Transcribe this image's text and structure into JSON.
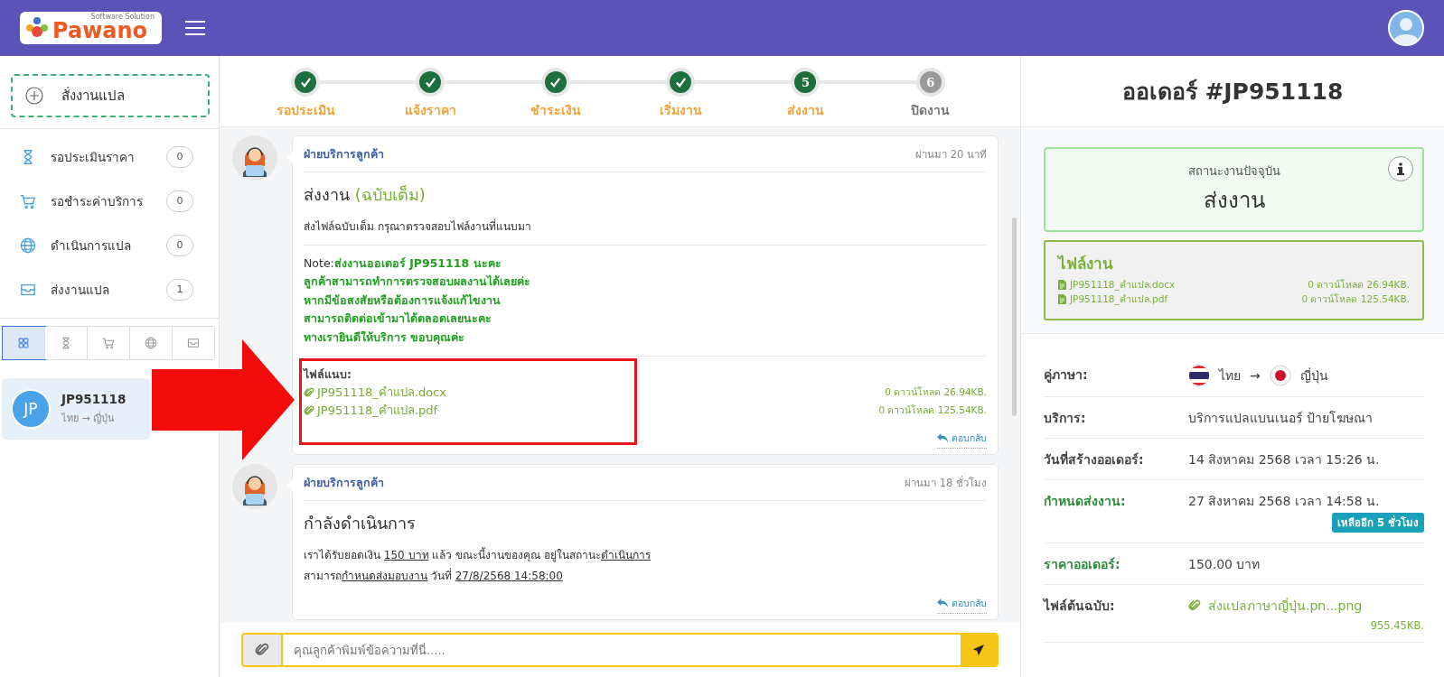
{
  "header": {
    "logo": {
      "name": "Pawano",
      "tagline": "Software Solution"
    }
  },
  "sidebar": {
    "new_order": "สั่งงานแปล",
    "menu": [
      {
        "label": "รอประเมินราคา",
        "count": "0"
      },
      {
        "label": "รอชำระค่าบริการ",
        "count": "0"
      },
      {
        "label": "ดำเนินการแปล",
        "count": "0"
      },
      {
        "label": "ส่งงานแปล",
        "count": "1"
      }
    ],
    "filters": [
      {
        "selected": true
      },
      {
        "selected": false
      },
      {
        "selected": false
      },
      {
        "selected": false
      },
      {
        "selected": false
      }
    ],
    "orders": [
      {
        "initials": "JP",
        "code": "JP951118",
        "languages": "ไทย → ญี่ปุ่น",
        "selected": true
      }
    ]
  },
  "steps": [
    {
      "label": "รอประเมิน",
      "completed": true,
      "active": true
    },
    {
      "label": "แจ้งราคา",
      "completed": true,
      "active": true
    },
    {
      "label": "ชำระเงิน",
      "completed": true,
      "active": true
    },
    {
      "label": "เริ่มงาน",
      "completed": true,
      "active": true
    },
    {
      "label": "ส่งงาน",
      "completed": false,
      "active": true,
      "number": "5"
    },
    {
      "label": "ปิดงาน",
      "completed": false,
      "active": false,
      "number": "6"
    }
  ],
  "messages": [
    {
      "sender": "ฝ่ายบริการลูกค้า",
      "time": "ผ่านมา 20 นาที",
      "title": "ส่งงาน",
      "title_note": "(ฉบับเต็ม)",
      "body": [
        [
          {
            "text": "ส่งไฟล์ฉบับเต็ม กรุณาตรวจสอบไฟล์งานที่แนบมา",
            "underline": false
          }
        ]
      ],
      "note_label": "Note:",
      "note_lines": [
        "ส่งงานออเดอร์ JP951118 นะคะ",
        "ลูกค้าสามารถทำการตรวจสอบผลงานได้เลยค่ะ",
        "หากมีข้อสงสัยหรือต้องการแจ้งแก้ไขงาน",
        "สามารถติดต่อเข้ามาได้ตลอดเลยนะคะ",
        "ทางเรายินดีให้บริการ ขอบคุณค่ะ"
      ],
      "attachments_label": "ไฟล์แนบ:",
      "attachments": [
        {
          "name": "JP951118_คำแปล.docx",
          "info": "0 ดาวน์โหลด 26.94KB."
        },
        {
          "name": "JP951118_คำแปล.pdf",
          "info": "0 ดาวน์โหลด 125.54KB."
        }
      ],
      "reply": "ตอบกลับ"
    },
    {
      "sender": "ฝ่ายบริการลูกค้า",
      "time": "ผ่านมา 18 ชั่วโมง",
      "title": "กำลังดำเนินการ",
      "body": [
        [
          {
            "text": "เราได้รับยอดเงิน ",
            "underline": false
          },
          {
            "text": "150 บาท",
            "underline": true
          },
          {
            "text": " แล้ว ขณะนี้งานของคุณ อยู่ในสถานะ",
            "underline": false
          },
          {
            "text": "ดำเนินการ",
            "underline": true
          }
        ],
        [
          {
            "text": "สามารถ",
            "underline": false
          },
          {
            "text": "กำหนดส่งมอบงาน",
            "underline": true
          },
          {
            "text": " วันที่ ",
            "underline": false
          },
          {
            "text": "27/8/2568 14:58:00",
            "underline": true
          }
        ]
      ],
      "reply": "ตอบกลับ"
    }
  ],
  "composer": {
    "placeholder": "คุณลูกค้าพิมพ์ข้อความที่นี่....."
  },
  "order": {
    "title": "ออเดอร์ #JP951118",
    "status": {
      "label": "สถานะงานปัจจุบัน",
      "value": "ส่งงาน"
    },
    "files": {
      "title": "ไฟล์งาน",
      "items": [
        {
          "name": "JP951118_คำแปล.docx",
          "info": "0 ดาวน์โหลด 26.94KB."
        },
        {
          "name": "JP951118_คำแปล.pdf",
          "info": "0 ดาวน์โหลด 125.54KB."
        }
      ]
    },
    "details": [
      {
        "kind": "languages",
        "label": "คู่ภาษา:",
        "highlight": false,
        "from": "ไทย",
        "arrow": "→",
        "to": "ญี่ปุ่น"
      },
      {
        "kind": "text",
        "label": "บริการ:",
        "highlight": false,
        "value": "บริการแปลแบนเนอร์ ป้ายโฆษณา"
      },
      {
        "kind": "text",
        "label": "วันที่สร้างออเดอร์:",
        "highlight": false,
        "value": "14 สิงหาคม 2568 เวลา 15:26 น."
      },
      {
        "kind": "badge",
        "label": "กำหนดส่งงาน:",
        "highlight": true,
        "value": "27 สิงหาคม 2568 เวลา 14:58 น.",
        "badge": "เหลืออีก 5 ชั่วโมง"
      },
      {
        "kind": "text",
        "label": "ราคาออเดอร์:",
        "highlight": true,
        "value": "150.00 บาท"
      },
      {
        "kind": "file",
        "label": "ไฟล์ต้นฉบับ:",
        "highlight": false,
        "value": "ส่งแปลภาษาญี่ปุ่น.pn...png",
        "size": "955.45KB."
      }
    ]
  }
}
